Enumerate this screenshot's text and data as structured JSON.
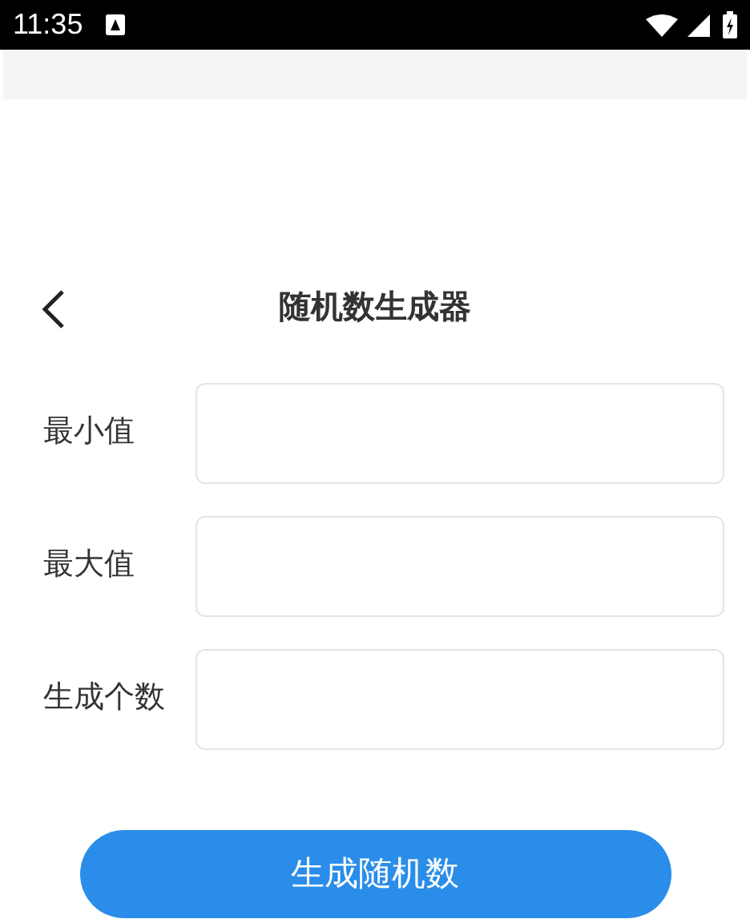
{
  "status_bar": {
    "time": "11:35"
  },
  "header": {
    "title": "随机数生成器"
  },
  "fields": [
    {
      "label": "最小值"
    },
    {
      "label": "最大值"
    },
    {
      "label": "生成个数"
    }
  ],
  "button": {
    "label": "生成随机数"
  }
}
